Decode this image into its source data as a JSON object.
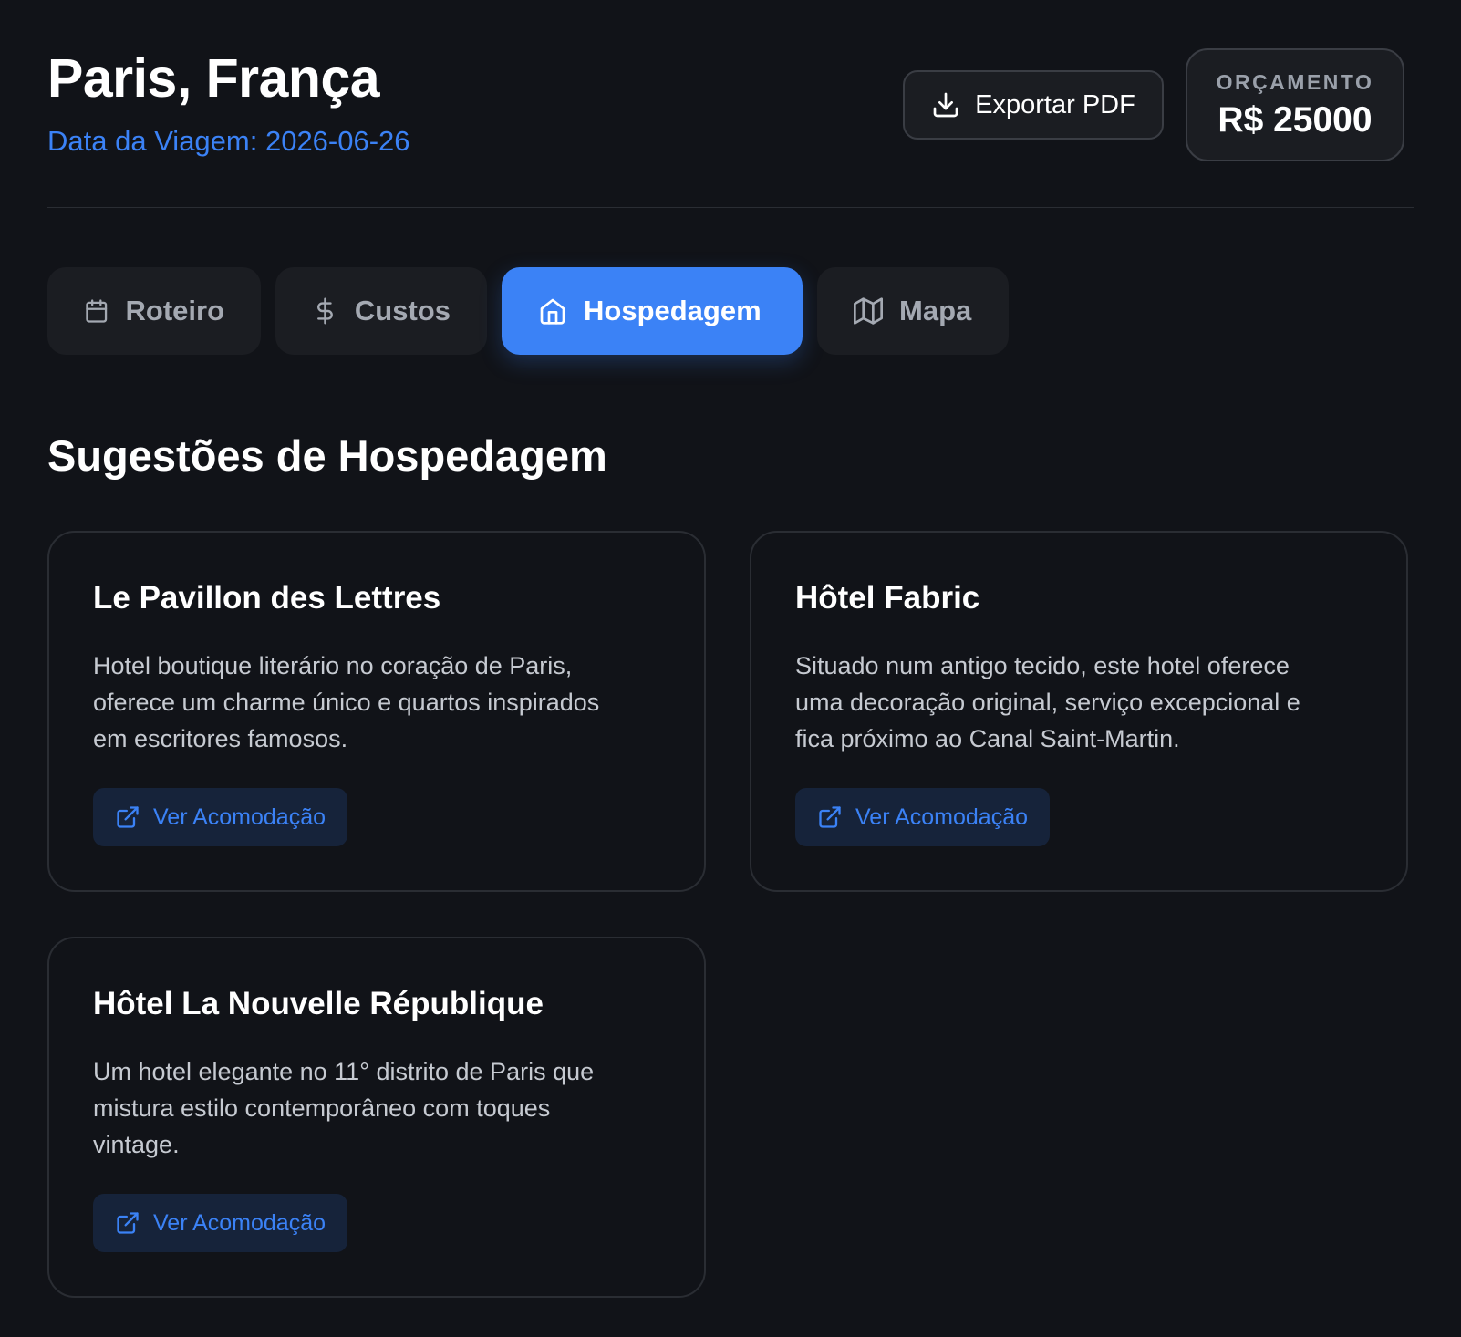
{
  "header": {
    "title": "Paris, França",
    "trip_date": "Data da Viagem: 2026-06-26",
    "export_label": "Exportar PDF",
    "budget_label": "ORÇAMENTO",
    "budget_value": "R$ 25000"
  },
  "tabs": [
    {
      "label": "Roteiro",
      "icon": "calendar-icon",
      "active": false
    },
    {
      "label": "Custos",
      "icon": "dollar-icon",
      "active": false
    },
    {
      "label": "Hospedagem",
      "icon": "home-icon",
      "active": true
    },
    {
      "label": "Mapa",
      "icon": "map-icon",
      "active": false
    }
  ],
  "section": {
    "title": "Sugestões de Hospedagem"
  },
  "hotels": [
    {
      "name": "Le Pavillon des Lettres",
      "description": "Hotel boutique literário no coração de Paris, oferece um charme único e quartos inspirados em escritores famosos.",
      "button_label": "Ver Acomodação"
    },
    {
      "name": "Hôtel Fabric",
      "description": "Situado num antigo tecido, este hotel oferece uma decoração original, serviço excepcional e fica próximo ao Canal Saint-Martin.",
      "button_label": "Ver Acomodação"
    },
    {
      "name": "Hôtel La Nouvelle République",
      "description": "Um hotel elegante no 11° distrito de Paris que mistura estilo contemporâneo com toques vintage.",
      "button_label": "Ver Acomodação"
    }
  ],
  "colors": {
    "accent": "#3b82f6",
    "background": "#111318",
    "surface": "#1b1d22"
  }
}
